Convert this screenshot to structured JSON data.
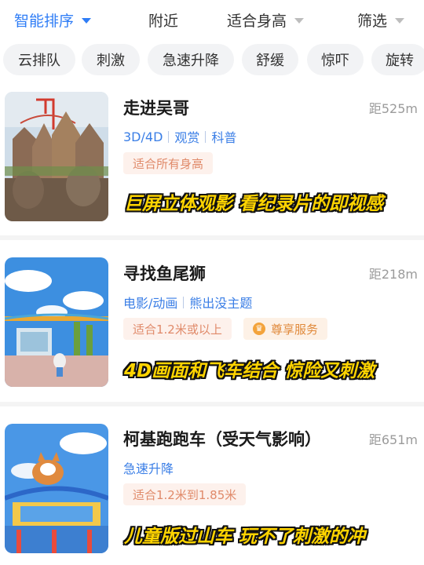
{
  "filters": [
    {
      "label": "智能排序",
      "active": true
    },
    {
      "label": "附近",
      "active": false
    },
    {
      "label": "适合身高",
      "active": false
    },
    {
      "label": "筛选",
      "active": false
    }
  ],
  "chips": [
    "云排队",
    "刺激",
    "急速升降",
    "舒缓",
    "惊吓",
    "旋转"
  ],
  "cards": [
    {
      "title": "走进吴哥",
      "distance": "距525m",
      "categories": [
        "3D/4D",
        "观赏",
        "科普"
      ],
      "height_tag": "适合所有身高",
      "service_tag": "",
      "caption": "巨屏立体观影 看纪录片的即视感",
      "thumb_icon": "angkor-temple-image"
    },
    {
      "title": "寻找鱼尾狮",
      "distance": "距218m",
      "categories": [
        "电影/动画",
        "熊出没主题"
      ],
      "height_tag": "适合1.2米或以上",
      "service_tag": "尊享服务",
      "caption": "4D画面和飞车结合 惊险又刺激",
      "thumb_icon": "park-plaza-image"
    },
    {
      "title": "柯基跑跑车（受天气影响）",
      "distance": "距651m",
      "categories": [
        "急速升降"
      ],
      "height_tag": "适合1.2米到1.85米",
      "service_tag": "",
      "caption": "儿童版过山车 玩不了刺激的冲",
      "thumb_icon": "corgi-coaster-image"
    }
  ],
  "colors": {
    "accent": "#2f7df6",
    "tag_bg": "#fdf1ec",
    "tag_text": "#e08a6a",
    "caption": "#ffd400"
  }
}
